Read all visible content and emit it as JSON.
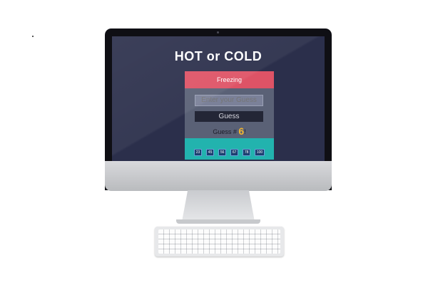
{
  "app": {
    "title": "HOT or COLD",
    "feedback": "Freezing",
    "input": {
      "placeholder": "Enter your Guess",
      "value": ""
    },
    "guess_button": "Guess",
    "guess_count_label": "Guess #",
    "guess_count": "6",
    "previous_guesses": [
      "23",
      "45",
      "56",
      "67",
      "78",
      "100"
    ]
  },
  "colors": {
    "screen_bg": "#2b2f4b",
    "feedback_bar": "#de5366",
    "panel": "#5a6176",
    "footer_bar": "#22b3ae",
    "count_highlight": "#f2b52e"
  }
}
